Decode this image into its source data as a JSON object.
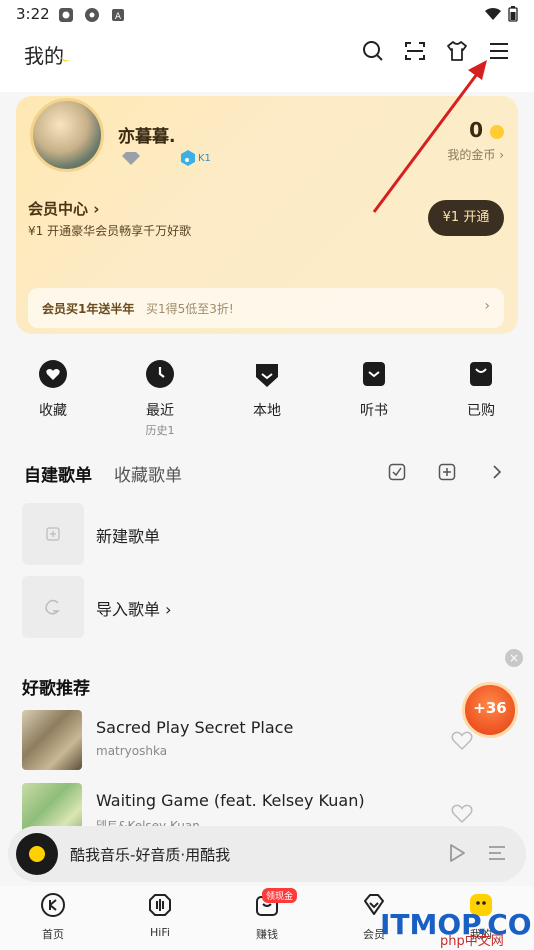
{
  "status_bar": {
    "time": "3:22",
    "icons": [
      "app-icon",
      "settings-icon",
      "a-icon",
      "wifi-icon",
      "battery-icon"
    ]
  },
  "header": {
    "title": "我的",
    "icons": [
      "search-icon",
      "scan-icon",
      "tshirt-icon",
      "menu-icon"
    ]
  },
  "vip_card": {
    "username": "亦暮暮.",
    "level_badge": "K1",
    "coins": "0",
    "coins_label": "我的金币",
    "vip_center": "会员中心",
    "vip_desc": "¥1 开通豪华会员畅享千万好歌",
    "open_button": "¥1 开通",
    "promo_title": "会员买1年送半年",
    "promo_desc": "买1得5低至3折!"
  },
  "quick_actions": [
    {
      "label": "收藏",
      "sub": ""
    },
    {
      "label": "最近",
      "sub": "历史1"
    },
    {
      "label": "本地",
      "sub": ""
    },
    {
      "label": "听书",
      "sub": ""
    },
    {
      "label": "已购",
      "sub": ""
    }
  ],
  "playlist_tabs": {
    "active": "自建歌单",
    "inactive": "收藏歌单"
  },
  "playlist_actions": {
    "create": "新建歌单",
    "import": "导入歌单"
  },
  "recommend": {
    "title": "好歌推荐",
    "songs": [
      {
        "name": "Sacred Play Secret Place",
        "artist": "matryoshka"
      },
      {
        "name": "Waiting Game (feat. Kelsey Kuan)",
        "artist": "델트&Kelsey Kuan"
      }
    ]
  },
  "bonus": {
    "value": "+36"
  },
  "mini_player": {
    "text": "酷我音乐-好音质·用酷我"
  },
  "tab_bar": {
    "tabs": [
      "首页",
      "HiFi",
      "赚钱",
      "会员",
      "我的"
    ],
    "earn_badge": "领现金"
  },
  "watermark": {
    "main": "ITMOP.COM",
    "sub": "php中文网"
  }
}
